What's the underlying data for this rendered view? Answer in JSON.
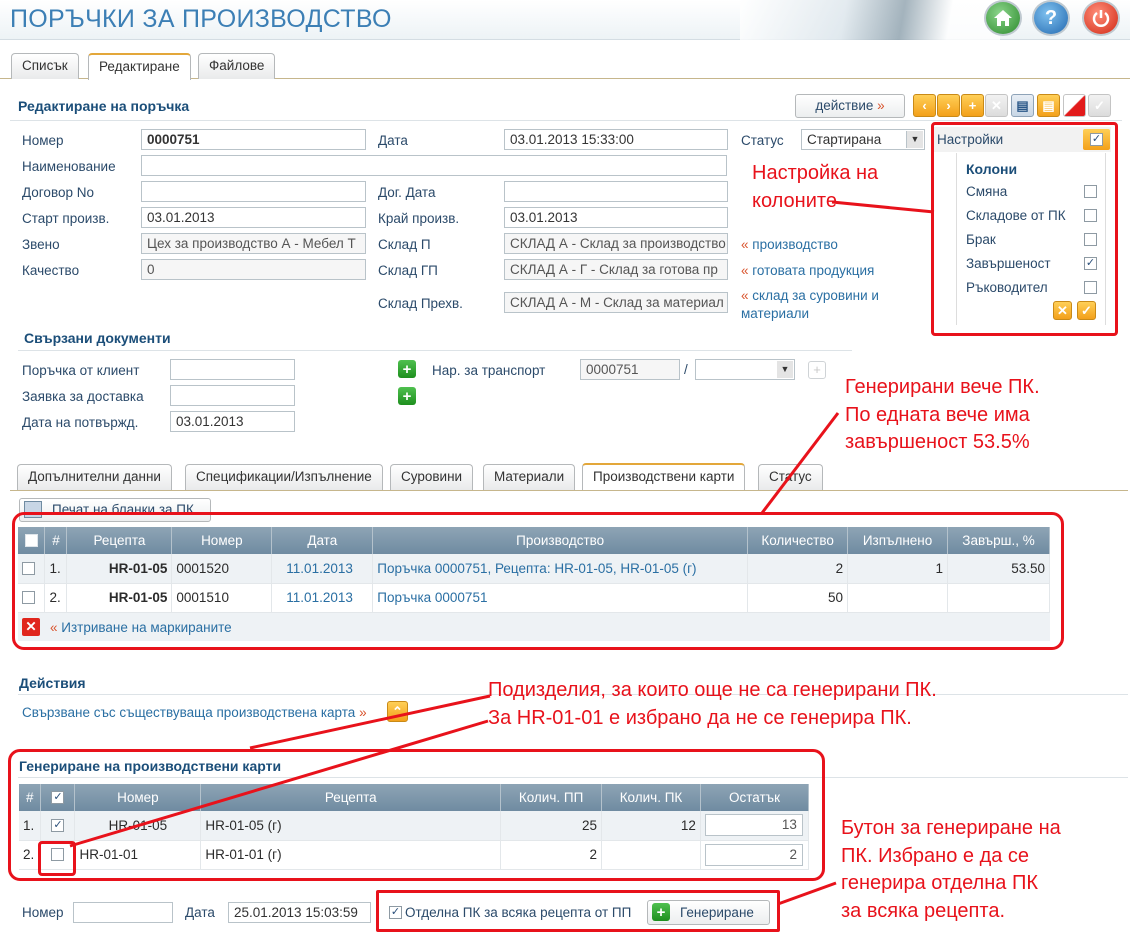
{
  "app_title": "ПОРЪЧКИ ЗА ПРОИЗВОДСТВО",
  "tabs": [
    "Списък",
    "Редактиране",
    "Файлове"
  ],
  "form": {
    "title": "Редактиране на поръчка",
    "action_label": "действие",
    "number_label": "Номер",
    "number": "0000751",
    "date_label": "Дата",
    "date": "03.01.2013 15:33:00",
    "status_label": "Статус",
    "status": "Стартирана",
    "name_label": "Наименование",
    "name": "",
    "contract_label": "Договор No",
    "contract": "",
    "contract_date_label": "Дог. Дата",
    "contract_date": "",
    "start_label": "Старт произв.",
    "start": "03.01.2013",
    "end_label": "Край произв.",
    "end": "03.01.2013",
    "unit_label": "Звено",
    "unit": "Цех за производство А - Мебел Т",
    "warehouse_p_label": "Склад П",
    "warehouse_p": "СКЛАД А - Склад за производство",
    "warehouse_p_link": "производство",
    "quality_label": "Качество",
    "quality": "0",
    "warehouse_gp_label": "Склад ГП",
    "warehouse_gp": "СКЛАД А - Г - Склад за готова пр",
    "warehouse_gp_link": "готовата продукция",
    "warehouse_m_label": "Склад Прехв.",
    "warehouse_m": "СКЛАД А - М - Склад за материал",
    "warehouse_m_link_1": "склад за суровини и",
    "warehouse_m_link_2": "материали"
  },
  "settings": {
    "title": "Настройки",
    "columns_title": "Колони",
    "items": [
      {
        "label": "Смяна",
        "checked": ""
      },
      {
        "label": "Складове от ПК",
        "checked": ""
      },
      {
        "label": "Брак",
        "checked": ""
      },
      {
        "label": "Завършеност",
        "checked": "✓"
      },
      {
        "label": "Ръководител",
        "checked": ""
      }
    ]
  },
  "related": {
    "title": "Свързани документи",
    "client_order_label": "Поръчка от клиент",
    "client_order": "",
    "delivery_label": "Заявка за доставка",
    "delivery": "",
    "confirm_label": "Дата на потвържд.",
    "confirm": "03.01.2013",
    "transport_label": "Нар. за транспорт",
    "transport": "0000751",
    "slash": "/"
  },
  "subtabs": [
    "Допълнителни данни",
    "Спецификации/Изпълнение",
    "Суровини",
    "Материали",
    "Производствени карти",
    "Статус"
  ],
  "print_button": "Печат на бланки за ПК",
  "cards_table": {
    "headers": [
      "#",
      "Рецепта",
      "Номер",
      "Дата",
      "Производство",
      "Количество",
      "Изпълнено",
      "Завърш., %"
    ],
    "rows": [
      {
        "n": "1.",
        "recipe": "HR-01-05",
        "number": "0001520",
        "date": "11.01.2013",
        "prod": "Поръчка 0000751, Рецепта: HR-01-05, HR-01-05 (г)",
        "qty": "2",
        "done": "1",
        "pct": "53.50"
      },
      {
        "n": "2.",
        "recipe": "HR-01-05",
        "number": "0001510",
        "date": "11.01.2013",
        "prod": "Поръчка 0000751",
        "qty": "50",
        "done": "",
        "pct": ""
      }
    ],
    "delete_label": "Изтриване на маркираните"
  },
  "actions": {
    "title": "Действия",
    "link_label": "Свързване със съществуваща производствена карта"
  },
  "generate": {
    "title": "Генериране на производствени карти",
    "headers": [
      "#",
      "Номер",
      "Рецепта",
      "Колич. ПП",
      "Колич. ПК",
      "Остатък"
    ],
    "rows": [
      {
        "n": "1.",
        "checked": "✓",
        "number": "HR-01-05",
        "recipe": "HR-01-05 (г)",
        "qty_pp": "25",
        "qty_pk": "12",
        "rest": "13"
      },
      {
        "n": "2.",
        "checked": "",
        "number": "HR-01-01",
        "recipe": "HR-01-01 (г)",
        "qty_pp": "2",
        "qty_pk": "",
        "rest": "2"
      }
    ],
    "number_label": "Номер",
    "number": "",
    "date_label": "Дата",
    "date": "25.01.2013 15:03:59",
    "separate_label": "Отделна ПК за всяка рецепта от ПП",
    "separate_checked": "✓",
    "generate_button": "Генериране"
  },
  "annotations": {
    "a1": [
      "Настройка на",
      "колоните"
    ],
    "a2": [
      "Генерирани вече ПК.",
      "По едната вече има",
      "завършеност 53.5%"
    ],
    "a3": [
      "Подизделия, за които още не са генерирани ПК.",
      "За HR-01-01 е избрано да не се генерира ПК."
    ],
    "a4": [
      "Бутон за генериране на",
      "ПК. Избрано е да се",
      "генерира отделна ПК",
      "за всяка рецепта."
    ]
  },
  "colors": {
    "accent": "#3c7fb5",
    "annotation": "#e8121b",
    "grid_header": "#7f97ab"
  }
}
